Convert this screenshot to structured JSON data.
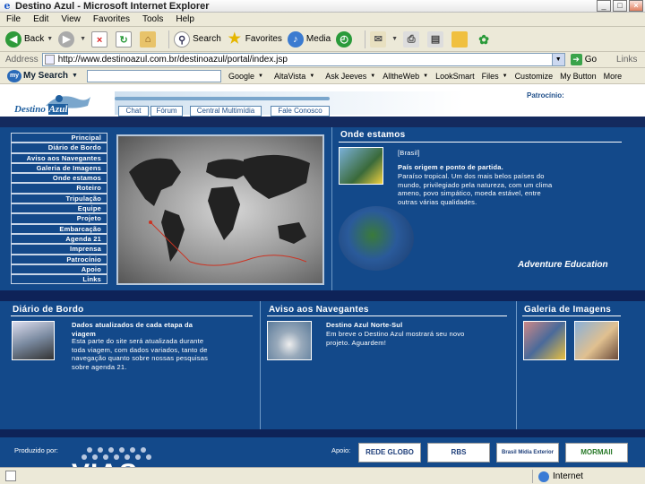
{
  "window": {
    "title": "Destino Azul - Microsoft Internet Explorer"
  },
  "menubar": [
    "File",
    "Edit",
    "View",
    "Favorites",
    "Tools",
    "Help"
  ],
  "toolbar": {
    "back": "Back",
    "search": "Search",
    "favorites": "Favorites",
    "media": "Media"
  },
  "address": {
    "label": "Address",
    "url": "http://www.destinoazul.com.br/destinoazul/portal/index.jsp",
    "go": "Go",
    "links": "Links"
  },
  "searchbar": {
    "brand": "My Search",
    "items": [
      "Google",
      "AltaVista",
      "Ask Jeeves",
      "AlltheWeb",
      "LookSmart",
      "Files",
      "Customize",
      "My Button",
      "More"
    ]
  },
  "site": {
    "logo_a": "Destino",
    "logo_b": "Azul",
    "nav": [
      "Chat",
      "Fórum",
      "Central Multimídia",
      "Fale Conosco"
    ],
    "patrocinio": "Patrocínio:",
    "menu": [
      "Principal",
      "Diário de Bordo",
      "Aviso aos Navegantes",
      "Galeria de Imagens",
      "Onde estamos",
      "Roteiro",
      "Tripulação",
      "Equipe",
      "Projeto",
      "Embarcação",
      "Agenda 21",
      "Imprensa",
      "Patrocínio",
      "Apoio",
      "Links"
    ],
    "onde": {
      "title": "Onde estamos",
      "tag": "[Brasil]",
      "headline": "País origem e ponto de partida.",
      "body": "Paraíso tropical. Um dos mais belos países do mundo, privilegiado pela natureza, com um clima ameno, povo simpático, moeda estável, entre outras várias qualidades."
    },
    "adventure": "Adventure Education",
    "diario": {
      "title": "Diário de Bordo",
      "headline": "Dados atualizados de cada etapa da viagem",
      "body": "Esta parte do site será atualizada durante toda viagem, com dados variados, tanto de navegação quanto sobre nossas pesquisas sobre agenda 21."
    },
    "aviso": {
      "title": "Aviso aos Navegantes",
      "headline": "Destino Azul Norte-Sul",
      "body": "Em breve o Destino Azul mostrará seu novo projeto. Aguardem!"
    },
    "galeria": {
      "title": "Galeria de Imagens"
    },
    "produzido": "Produzido por:",
    "vias": "VIAS",
    "apoio": "Apoio:",
    "sponsors": [
      "REDE GLOBO",
      "RBS",
      "Brasil Mídia Exterior",
      "MORMAII"
    ]
  },
  "status": {
    "zone": "Internet"
  }
}
